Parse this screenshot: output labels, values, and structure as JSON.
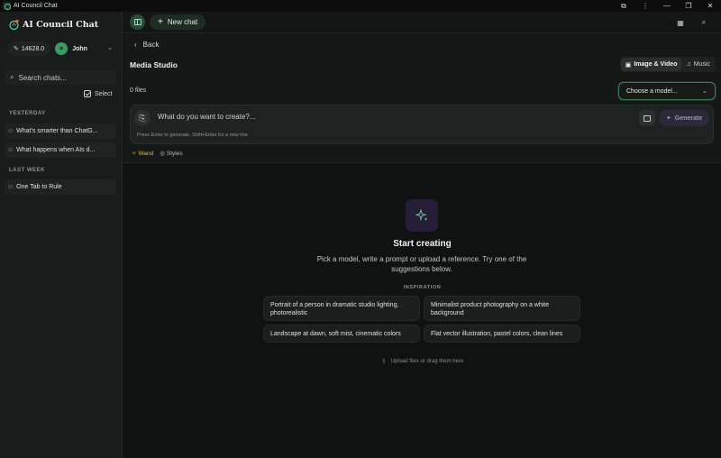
{
  "window": {
    "title": "AI Council Chat",
    "buttons": {
      "extension": "⧉",
      "more": "⋮",
      "minimize": "—",
      "restore": "❐",
      "close": "✕"
    }
  },
  "sidebar": {
    "brand": "AI Council Chat",
    "credits": "14628.0",
    "user_name": "John",
    "search_placeholder": "Search chats...",
    "select_label": "Select",
    "sections": [
      {
        "label": "YESTERDAY",
        "items": [
          "What's smarter than ChatG...",
          "What happens when AIs d..."
        ]
      },
      {
        "label": "LAST WEEK",
        "items": [
          "One Tab to Rule"
        ]
      }
    ]
  },
  "topbar": {
    "new_chat_label": "New chat"
  },
  "main": {
    "back_label": "Back",
    "title": "Media Studio",
    "tabs": [
      {
        "label": "Image & Video",
        "active": true
      },
      {
        "label": "Music",
        "active": false
      }
    ],
    "files_count": "0 files",
    "model_placeholder": "Choose a model...",
    "prompt_placeholder": "What do you want to create?...",
    "prompt_hint": "Press Enter to generate, Shift+Enter for a new line",
    "generate_label": "Generate",
    "tools": {
      "wand": "Wand",
      "styles": "Styles"
    },
    "empty": {
      "title": "Start creating",
      "subtitle": "Pick a model, write a prompt or upload a reference. Try one of the suggestions below.",
      "inspiration_label": "INSPIRATION",
      "suggestions": [
        "Portrait of a person in dramatic studio lighting, photorealistic",
        "Minimalist product photography on a white background",
        "Landscape at dawn, soft mist, cinematic colors",
        "Flat vector illustration, pastel colors, clean lines"
      ],
      "upload_hint": "Upload files or drag them here"
    }
  },
  "colors": {
    "accent": "#3d9a64",
    "wand": "#e1b64a",
    "generate": "#2c2a3a"
  }
}
